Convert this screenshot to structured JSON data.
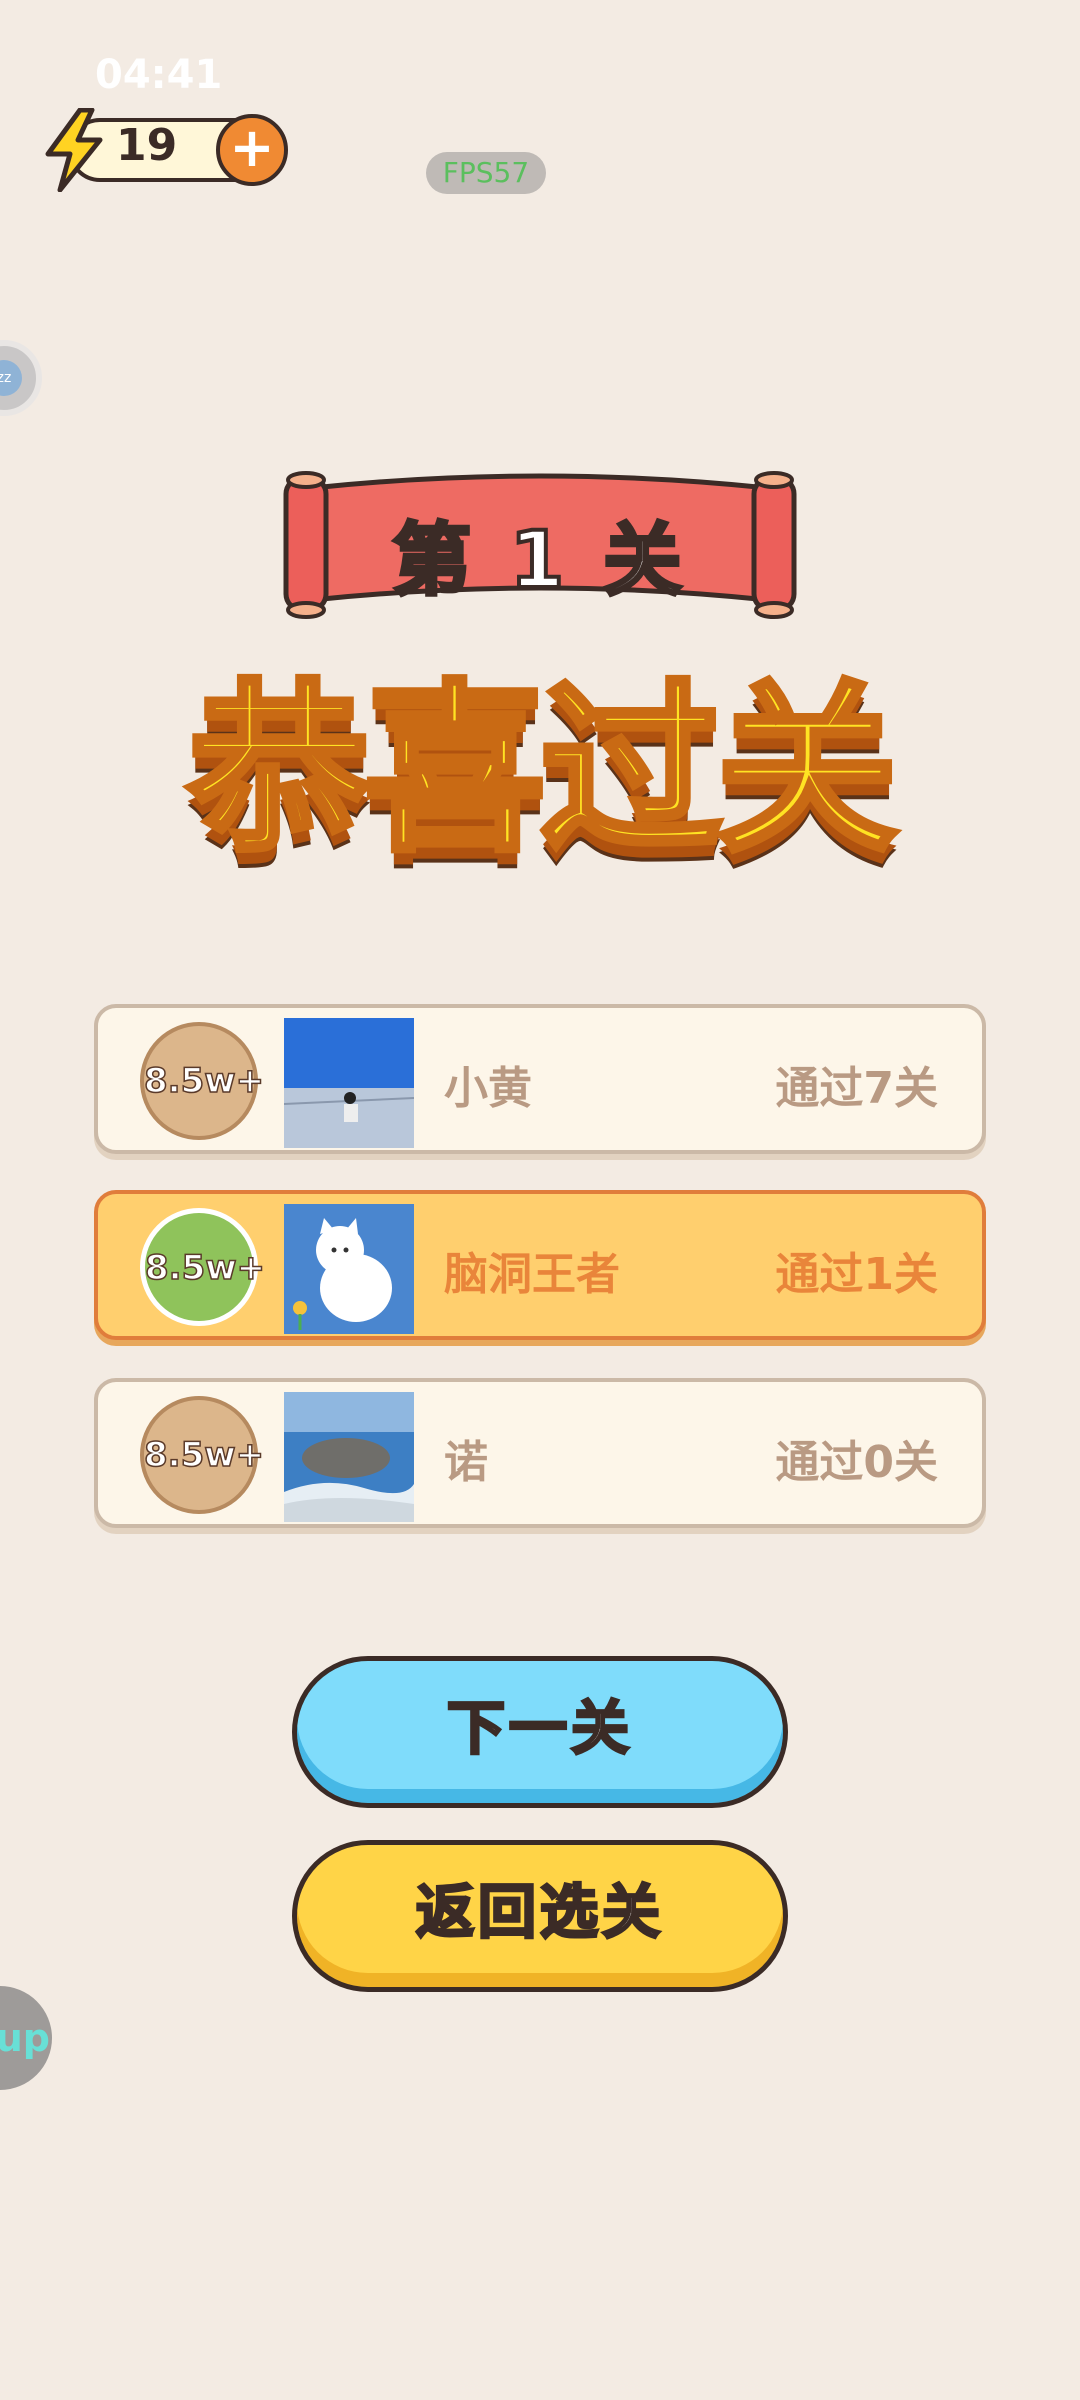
{
  "status_bar": {
    "time": "04:41"
  },
  "energy": {
    "count": "19",
    "plus_label": "+"
  },
  "fps_label": "FPS57",
  "side_bubble_text": "zz",
  "level_ribbon": {
    "text": "第 1 关"
  },
  "congrats_title": "恭喜过关",
  "leaderboard": [
    {
      "badge": "8.5w+",
      "name": "小黄",
      "progress": "通过7关",
      "highlight": false
    },
    {
      "badge": "8.5w+",
      "name": "脑洞王者",
      "progress": "通过1关",
      "highlight": true
    },
    {
      "badge": "8.5w+",
      "name": "诺",
      "progress": "通过0关",
      "highlight": false
    }
  ],
  "buttons": {
    "next_level": "下一关",
    "back_to_levels": "返回选关"
  },
  "float_button_text": "up",
  "colors": {
    "background": "#f3ebe3",
    "ribbon": "#ee6b63",
    "title_yellow": "#ffe323",
    "highlight_row": "#ffcf6e",
    "blue_button": "#7fdcfb",
    "yellow_button": "#ffd447"
  }
}
